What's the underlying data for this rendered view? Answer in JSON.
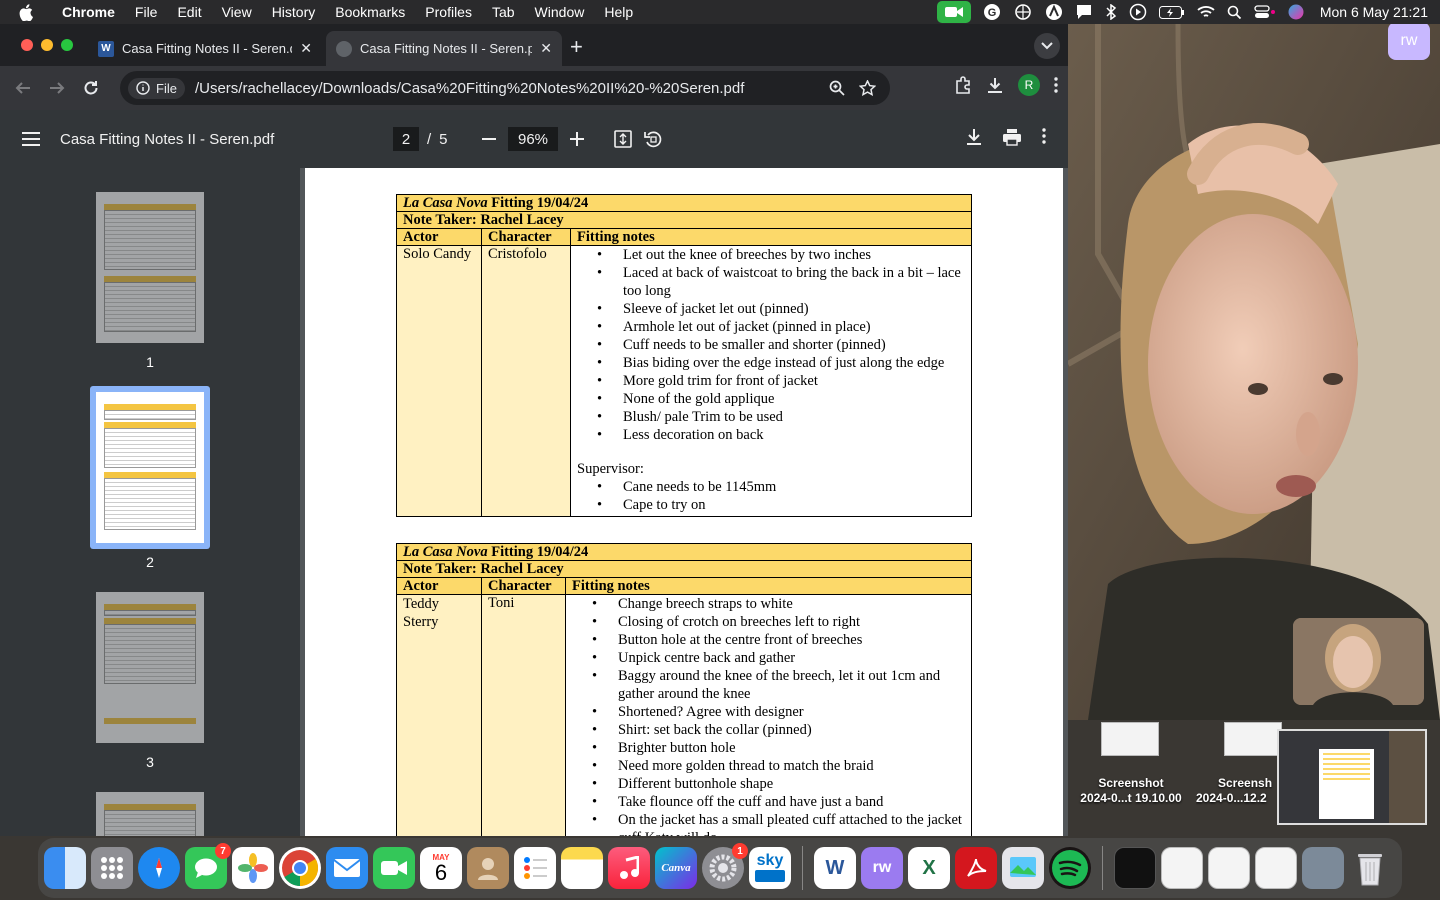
{
  "menubar": {
    "app": "Chrome",
    "items": [
      "File",
      "Edit",
      "View",
      "History",
      "Bookmarks",
      "Profiles",
      "Tab",
      "Window",
      "Help"
    ],
    "clock": "Mon 6 May  21:21"
  },
  "tabs": {
    "inactive_title": "Casa Fitting Notes II - Seren.d",
    "active_title": "Casa Fitting Notes II - Seren.p"
  },
  "omnibox": {
    "chip_label": "File",
    "url": "/Users/rachellacey/Downloads/Casa%20Fitting%20Notes%20II%20-%20Seren.pdf"
  },
  "profile_initial": "R",
  "pdf": {
    "title": "Casa Fitting Notes II - Seren.pdf",
    "current_page": "2",
    "separator": "/",
    "total_pages": "5",
    "zoom": "96%"
  },
  "thumbnails": [
    "1",
    "2",
    "3"
  ],
  "note1": {
    "title_italic": "La Casa Nova",
    "title_rest": " Fitting 19/04/24",
    "note_taker": "Note Taker: Rachel Lacey",
    "col_actor": "Actor",
    "col_character": "Character",
    "col_notes": "Fitting notes",
    "actor": "Solo Candy",
    "character": "Cristofolo",
    "notes": [
      "Let out the knee of breeches by two inches",
      "Laced at back of waistcoat to bring the back in a bit – lace too long",
      "Sleeve of jacket let out (pinned)",
      "Armhole let out of jacket (pinned in place)",
      "Cuff needs to be smaller and shorter (pinned)",
      "Bias biding over the edge instead of just along the edge",
      "More gold trim for front of jacket",
      "None of the gold applique",
      "Blush/ pale Trim to be used",
      "Less decoration on back"
    ],
    "supervisor_label": "Supervisor:",
    "supervisor_notes": [
      "Cane needs to be 1145mm",
      "Cape to try on"
    ]
  },
  "note2": {
    "title_italic": "La Casa Nova",
    "title_rest": " Fitting 19/04/24",
    "note_taker": "Note Taker: Rachel Lacey",
    "col_actor": "Actor",
    "col_character": "Character",
    "col_notes": "Fitting notes",
    "actor": "Teddy Sterry",
    "character": "Toni",
    "notes": [
      "Change breech straps to white",
      "Closing of crotch on breeches left to right",
      "Button hole at the centre front of breeches",
      "Unpick centre back and gather",
      "Baggy around the knee of the breech, let it out 1cm and gather around the knee",
      "Shortened? Agree with designer",
      "Shirt: set back the collar (pinned)",
      "Brighter button hole",
      "Need more golden thread to match the braid",
      "Different buttonhole shape",
      "Take flounce off the cuff and have just a band",
      "On the jacket has a small pleated cuff attached to the jacket cuff Katy will do"
    ]
  },
  "desktop": {
    "file1_line1": "Screenshot",
    "file1_line2": "2024-0...t 19.10.00",
    "file2_line1": "Screensh",
    "file2_line2": "2024-0...12.2"
  },
  "rw_badge": "rw",
  "dock": {
    "calendar_month": "MAY",
    "calendar_day": "6",
    "messages_badge": "7",
    "settings_badge": "1",
    "canva_label": "Canva",
    "sky_label": "sky",
    "word_label": "W",
    "excel_label": "X",
    "rw_label": "rw"
  },
  "colors": {
    "header_yellow": "#fcd96a",
    "cell_yellow": "#fff1c2",
    "chrome_dark": "#202124",
    "pdf_toolbar": "#323639"
  }
}
